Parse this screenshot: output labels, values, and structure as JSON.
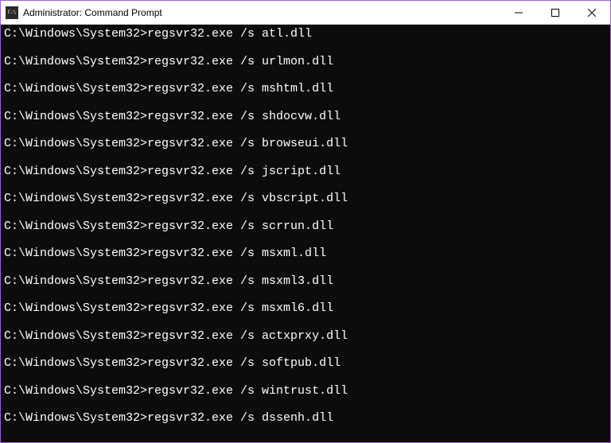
{
  "window": {
    "title": "Administrator: Command Prompt"
  },
  "terminal": {
    "prompt": "C:\\Windows\\System32>",
    "commands": [
      "regsvr32.exe /s atl.dll",
      "regsvr32.exe /s urlmon.dll",
      "regsvr32.exe /s mshtml.dll",
      "regsvr32.exe /s shdocvw.dll",
      "regsvr32.exe /s browseui.dll",
      "regsvr32.exe /s jscript.dll",
      "regsvr32.exe /s vbscript.dll",
      "regsvr32.exe /s scrrun.dll",
      "regsvr32.exe /s msxml.dll",
      "regsvr32.exe /s msxml3.dll",
      "regsvr32.exe /s msxml6.dll",
      "regsvr32.exe /s actxprxy.dll",
      "regsvr32.exe /s softpub.dll",
      "regsvr32.exe /s wintrust.dll",
      "regsvr32.exe /s dssenh.dll"
    ]
  }
}
